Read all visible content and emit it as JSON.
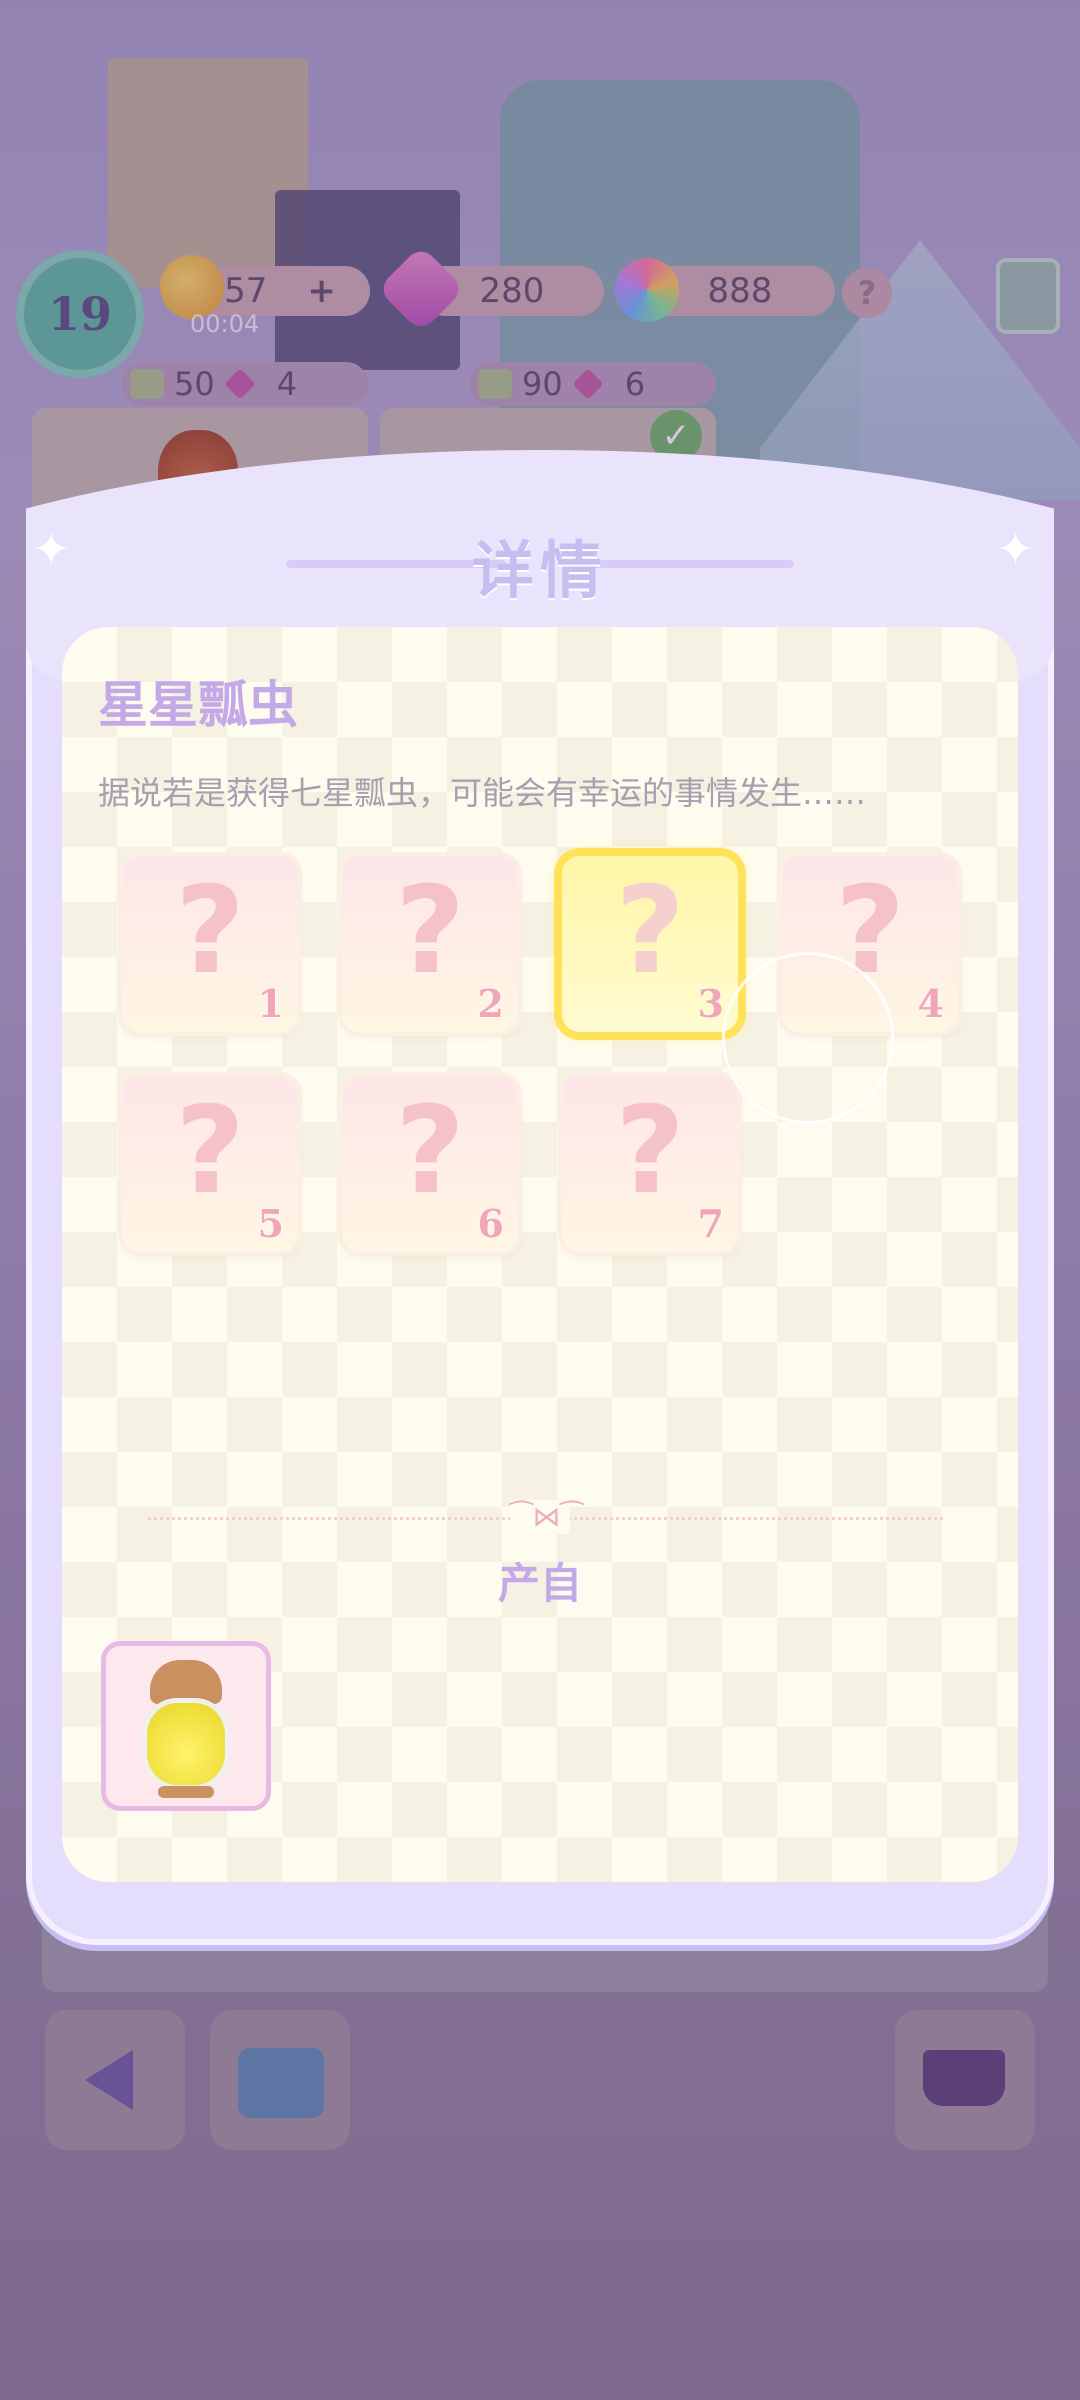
{
  "hud": {
    "level": "19",
    "energy": "57",
    "energy_plus": "+",
    "energy_timer": "00:04",
    "gems": "280",
    "flowers": "888",
    "help": "?"
  },
  "missions": [
    {
      "exp": "50",
      "gem_cost": "4"
    },
    {
      "exp": "90",
      "gem_cost": "6"
    }
  ],
  "modal": {
    "title": "详情",
    "item_name": "星星瓢虫",
    "item_description": "据说若是获得七星瓢虫，可能会有幸运的事情发生……",
    "slots": [
      {
        "symbol": "?",
        "number": "1"
      },
      {
        "symbol": "?",
        "number": "2"
      },
      {
        "symbol": "?",
        "number": "3"
      },
      {
        "symbol": "?",
        "number": "4"
      },
      {
        "symbol": "?",
        "number": "5"
      },
      {
        "symbol": "?",
        "number": "6"
      },
      {
        "symbol": "?",
        "number": "7"
      }
    ],
    "active_slot": 3,
    "source_label": "产自",
    "source_items": [
      {
        "icon": "lantern-icon"
      }
    ]
  },
  "colors": {
    "accent": "#c4a9e8",
    "highlight": "#ffe25a",
    "modal_frame": "#e4ddfb"
  }
}
